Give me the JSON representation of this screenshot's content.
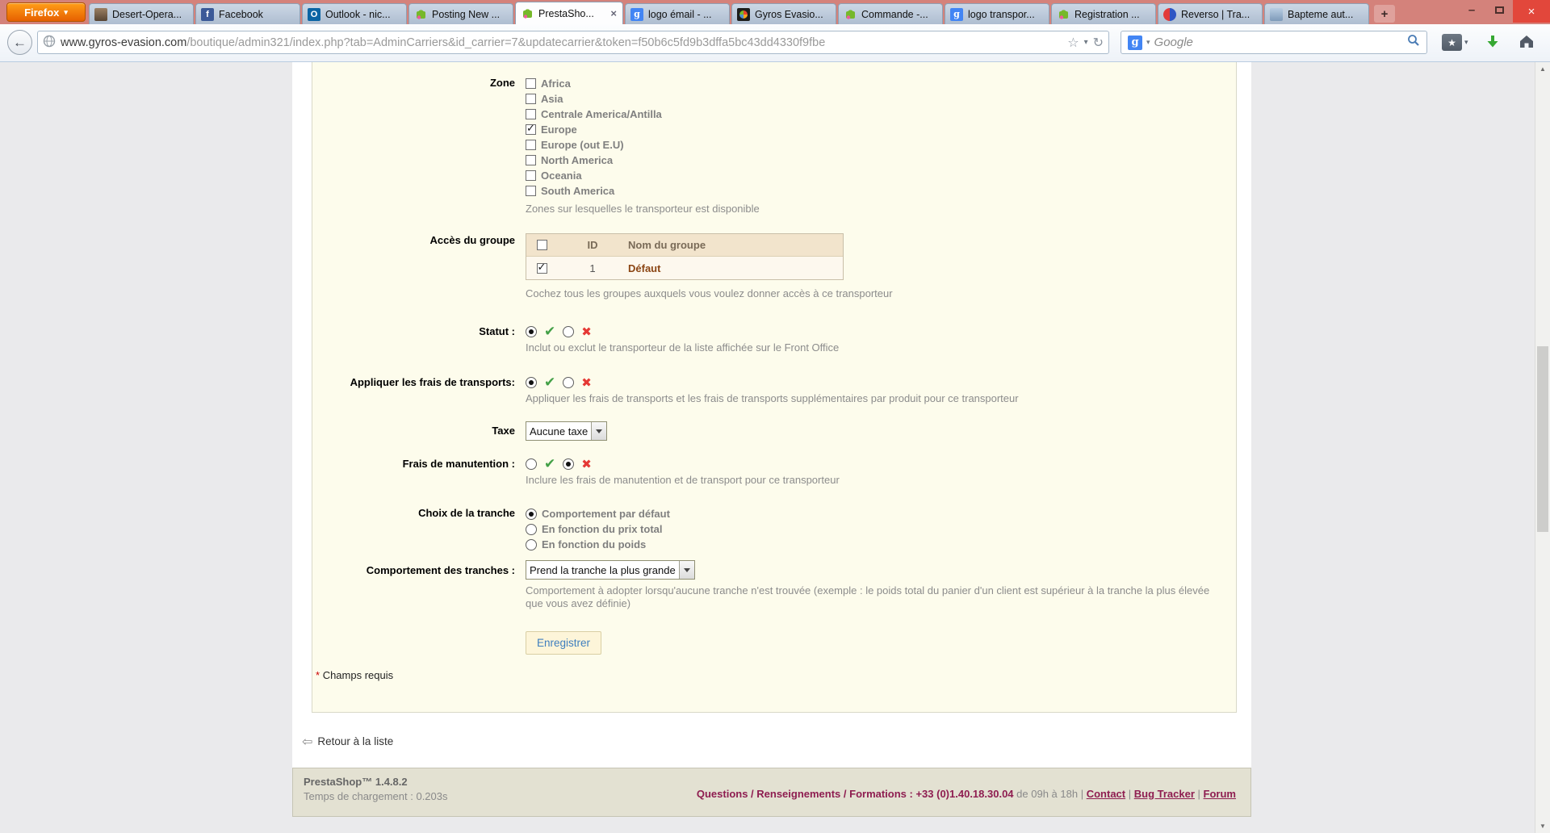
{
  "browser": {
    "firefox_button": "Firefox",
    "tabs": [
      {
        "title": "Desert-Opera...",
        "icon": "photo-favicon"
      },
      {
        "title": "Facebook",
        "icon": "facebook-favicon"
      },
      {
        "title": "Outlook - nic...",
        "icon": "outlook-favicon"
      },
      {
        "title": "Posting New ...",
        "icon": "prestashop-favicon"
      },
      {
        "title": "PrestaSho...",
        "icon": "prestashop-favicon",
        "active": true
      },
      {
        "title": "logo émail - ...",
        "icon": "google-favicon"
      },
      {
        "title": "Gyros Evasio...",
        "icon": "joomla-favicon"
      },
      {
        "title": "Commande -...",
        "icon": "prestashop-favicon"
      },
      {
        "title": "logo transpor...",
        "icon": "google-favicon"
      },
      {
        "title": "Registration ...",
        "icon": "prestashop-favicon"
      },
      {
        "title": "Reverso | Tra...",
        "icon": "reverso-favicon"
      },
      {
        "title": "Bapteme aut...",
        "icon": "photo-favicon"
      }
    ],
    "favicon_letters": {
      "facebook": "f",
      "outlook": "O",
      "google": "g"
    },
    "nav": {
      "url_host": "www.gyros-evasion.com",
      "url_path": "/boutique/admin321/index.php?tab=AdminCarriers&id_carrier=7&updatecarrier&token=f50b6c5fd9b3dffa5bc43dd4330f9fbe",
      "search_placeholder": "Google"
    }
  },
  "icons": {
    "firefox_caret": "▾",
    "tab_close": "×",
    "new_tab": "+",
    "window_minimize": "–",
    "window_close": "×",
    "back_arrow": "←",
    "bookmark_star_outline": "☆",
    "history_caret": "▾",
    "reload": "↻",
    "search_caret": "▾",
    "bookmarks_star": "★",
    "bookmarks_caret": "▾",
    "status_check": "✔",
    "status_cross": "✖",
    "back_list_arrow": "⇦",
    "scroll_up": "▲",
    "scroll_down": "▼"
  },
  "colors": {
    "accent_green": "#43a047",
    "accent_red": "#e53935",
    "fieldset_bg": "#fdfcec",
    "table_header_bg": "#f2e4cc",
    "footer_link": "#8e1d50",
    "titlebar_bg": "#d4827b"
  },
  "form": {
    "zone": {
      "label": "Zone",
      "options": [
        {
          "label": "Africa",
          "checked": false
        },
        {
          "label": "Asia",
          "checked": false
        },
        {
          "label": "Centrale America/Antilla",
          "checked": false
        },
        {
          "label": "Europe",
          "checked": true
        },
        {
          "label": "Europe (out E.U)",
          "checked": false
        },
        {
          "label": "North America",
          "checked": false
        },
        {
          "label": "Oceania",
          "checked": false
        },
        {
          "label": "South America",
          "checked": false
        }
      ],
      "hint": "Zones sur lesquelles le transporteur est disponible"
    },
    "group_access": {
      "label": "Accès du groupe",
      "headers": {
        "id": "ID",
        "name": "Nom du groupe"
      },
      "select_all_checked": false,
      "row": {
        "checked": true,
        "id": "1",
        "name": "Défaut"
      },
      "hint": "Cochez tous les groupes auxquels vous voulez donner accès à ce transporteur"
    },
    "statut": {
      "label": "Statut :",
      "on": true,
      "off": false,
      "hint": "Inclut ou exclut le transporteur de la liste affichée sur le Front Office"
    },
    "frais_transports": {
      "label": "Appliquer les frais de transports:",
      "on": true,
      "off": false,
      "hint": "Appliquer les frais de transports et les frais de transports supplémentaires par produit pour ce transporteur"
    },
    "taxe": {
      "label": "Taxe",
      "value": "Aucune taxe"
    },
    "manutention": {
      "label": "Frais de manutention :",
      "on": false,
      "off": true,
      "hint": "Inclure les frais de manutention et de transport pour ce transporteur"
    },
    "tranche_choice": {
      "label": "Choix de la tranche",
      "options": [
        {
          "label": "Comportement par défaut",
          "checked": true
        },
        {
          "label": "En fonction du prix total",
          "checked": false
        },
        {
          "label": "En fonction du poids",
          "checked": false
        }
      ]
    },
    "tranche_behavior": {
      "label": "Comportement des tranches :",
      "value": "Prend la tranche la plus grande",
      "hint": "Comportement à adopter lorsqu'aucune tranche n'est trouvée (exemple : le poids total du panier d'un client est supérieur à la tranche la plus élevée que vous avez définie)"
    },
    "save_label": "Enregistrer",
    "required_star": "*",
    "required_note": "Champs requis"
  },
  "back_link": "Retour à la liste",
  "footer": {
    "version": "PrestaShop™ 1.4.8.2",
    "load_time": "Temps de chargement : 0.203s",
    "right_main": "Questions / Renseignements / Formations : +33 (0)1.40.18.30.04",
    "right_hours": "de 09h à 18h",
    "links": [
      "Contact",
      "Bug Tracker",
      "Forum"
    ],
    "separator": "|"
  }
}
